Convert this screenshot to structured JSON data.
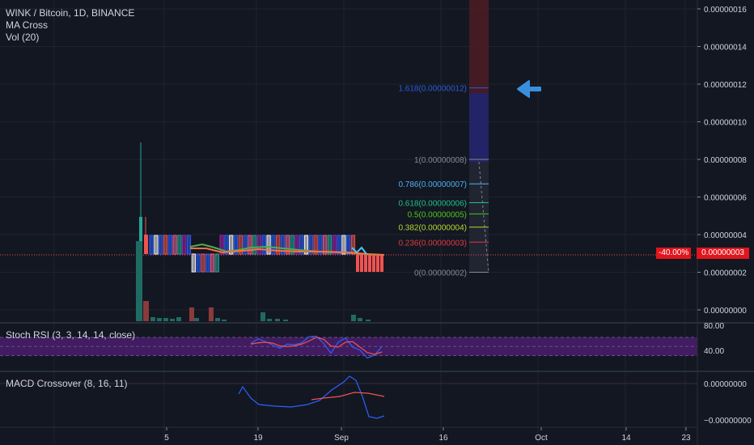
{
  "legend": {
    "symbol": "WINK / Bitcoin, 1D, BINANCE",
    "ma": "MA Cross",
    "vol": "Vol (20)"
  },
  "stoch": {
    "title": "Stoch RSI (3, 3, 14, 14, close)"
  },
  "macd": {
    "title": "MACD Crossover (8, 16, 11)"
  },
  "price_tag": {
    "pct": "-40.00%",
    "price": "0.00000003"
  },
  "colors": {
    "background": "#131722",
    "up": "#26a69a",
    "down": "#ef5350",
    "blue_candle": "#2962ff",
    "arrow": "#3a8fdc",
    "stoch_band": "#4a1d6b"
  },
  "chart_data": {
    "type": "candlestick",
    "price_axis": {
      "ticks": [
        "0.00000016",
        "0.00000014",
        "0.00000012",
        "0.00000010",
        "0.00000008",
        "0.00000006",
        "0.00000004",
        "0.00000002",
        "0.00000000"
      ]
    },
    "time_axis": {
      "ticks": [
        "5",
        "19",
        "Sep",
        "16",
        "Oct",
        "14",
        "23"
      ]
    },
    "fibonacci": [
      {
        "label": "1.618(0.00000012)",
        "value": 1.18e-07,
        "color": "#2a5bd7"
      },
      {
        "label": "1(0.00000008)",
        "value": 8e-08,
        "color": "#868993"
      },
      {
        "label": "0.786(0.00000007)",
        "value": 6.7e-08,
        "color": "#4fb0f0"
      },
      {
        "label": "0.618(0.00000006)",
        "value": 5.7e-08,
        "color": "#1ec08a"
      },
      {
        "label": "0.5(0.00000005)",
        "value": 5.1e-08,
        "color": "#52c41a"
      },
      {
        "label": "0.382(0.00000004)",
        "value": 4.4e-08,
        "color": "#b7d630"
      },
      {
        "label": "0.236(0.00000003)",
        "value": 3.6e-08,
        "color": "#e0393e"
      },
      {
        "label": "0(0.00000002)",
        "value": 2e-08,
        "color": "#868993"
      }
    ],
    "stoch_axis": {
      "ticks": [
        "80.00",
        "40.00"
      ]
    },
    "macd_axis": {
      "ticks": [
        "0.00000000",
        "−0.00000000"
      ]
    },
    "stoch_k": [
      60,
      75,
      66,
      55,
      44,
      58,
      56,
      62,
      82,
      84,
      60,
      28,
      64,
      78,
      48,
      38,
      12,
      22,
      50
    ],
    "stoch_d": [
      58,
      62,
      64,
      61,
      52,
      50,
      52,
      58,
      68,
      80,
      74,
      52,
      48,
      64,
      66,
      48,
      30,
      24,
      32
    ]
  }
}
